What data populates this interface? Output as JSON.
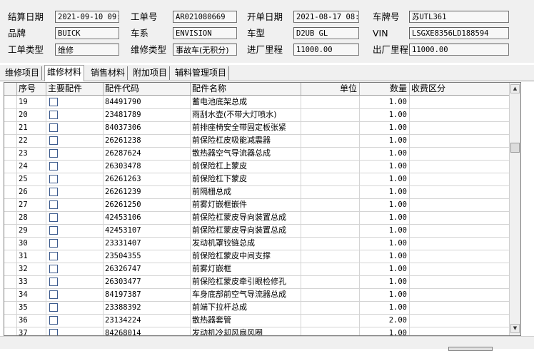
{
  "header": {
    "settle_date_label": "结算日期",
    "settle_date_value": "2021-09-10 09:5",
    "work_order_label": "工单号",
    "work_order_value": "AR021080669",
    "open_date_label": "开单日期",
    "open_date_value": "2021-08-17 08:",
    "plate_label": "车牌号",
    "plate_value": "苏UTL361",
    "brand_label": "品牌",
    "brand_value": "BUICK",
    "series_label": "车系",
    "series_value": "ENVISION",
    "model_label": "车型",
    "model_value": "D2UB GL",
    "vin_label": "VIN",
    "vin_value": "LSGXE8356LD188594",
    "job_type_label": "工单类型",
    "job_type_value": "维修",
    "repair_type_label": "维修类型",
    "repair_type_value": "事故车(无积分)",
    "in_mileage_label": "进厂里程",
    "in_mileage_value": "11000.00",
    "out_mileage_label": "出厂里程",
    "out_mileage_value": "11000.00"
  },
  "tabs": [
    "维修项目",
    "维修材料",
    "销售材料",
    "附加项目",
    "辅料管理项目"
  ],
  "active_tab": "维修材料",
  "table": {
    "columns": [
      "序号",
      "主要配件",
      "配件代码",
      "配件名称",
      "单位",
      "数量",
      "收费区分"
    ],
    "rows": [
      {
        "no": "19",
        "code": "84491790",
        "name": "蓄电池底架总成",
        "unit": "",
        "qty": "1.00",
        "fee": ""
      },
      {
        "no": "20",
        "code": "23481789",
        "name": "雨刮水壶(不带大灯喷水)",
        "unit": "",
        "qty": "1.00",
        "fee": ""
      },
      {
        "no": "21",
        "code": "84037306",
        "name": "前排座椅安全带固定板张紧",
        "unit": "",
        "qty": "1.00",
        "fee": ""
      },
      {
        "no": "22",
        "code": "26261238",
        "name": "前保险杠皮吸能减震器",
        "unit": "",
        "qty": "1.00",
        "fee": ""
      },
      {
        "no": "23",
        "code": "26287624",
        "name": "散热器空气导流器总成",
        "unit": "",
        "qty": "1.00",
        "fee": ""
      },
      {
        "no": "24",
        "code": "26303478",
        "name": "前保险杠上蒙皮",
        "unit": "",
        "qty": "1.00",
        "fee": ""
      },
      {
        "no": "25",
        "code": "26261263",
        "name": "前保险杠下蒙皮",
        "unit": "",
        "qty": "1.00",
        "fee": ""
      },
      {
        "no": "26",
        "code": "26261239",
        "name": "前隔栅总成",
        "unit": "",
        "qty": "1.00",
        "fee": ""
      },
      {
        "no": "27",
        "code": "26261250",
        "name": "前雾灯嵌框嵌件",
        "unit": "",
        "qty": "1.00",
        "fee": ""
      },
      {
        "no": "28",
        "code": "42453106",
        "name": "前保险杠蒙皮导向装置总成",
        "unit": "",
        "qty": "1.00",
        "fee": ""
      },
      {
        "no": "29",
        "code": "42453107",
        "name": "前保险杠蒙皮导向装置总成",
        "unit": "",
        "qty": "1.00",
        "fee": ""
      },
      {
        "no": "30",
        "code": "23331407",
        "name": "发动机罩铰链总成",
        "unit": "",
        "qty": "1.00",
        "fee": ""
      },
      {
        "no": "31",
        "code": "23504355",
        "name": "前保险杠蒙皮中间支撑",
        "unit": "",
        "qty": "1.00",
        "fee": ""
      },
      {
        "no": "32",
        "code": "26326747",
        "name": "前雾灯嵌框",
        "unit": "",
        "qty": "1.00",
        "fee": ""
      },
      {
        "no": "33",
        "code": "26303477",
        "name": "前保险杠蒙皮牵引眼检修孔",
        "unit": "",
        "qty": "1.00",
        "fee": ""
      },
      {
        "no": "34",
        "code": "84197387",
        "name": "车身底部前空气导流器总成",
        "unit": "",
        "qty": "1.00",
        "fee": ""
      },
      {
        "no": "35",
        "code": "23388392",
        "name": "前端下拉杆总成",
        "unit": "",
        "qty": "1.00",
        "fee": ""
      },
      {
        "no": "36",
        "code": "23134224",
        "name": "散热器套管",
        "unit": "",
        "qty": "2.00",
        "fee": ""
      },
      {
        "no": "37",
        "code": "84268014",
        "name": "发动机冷却风扇风圈",
        "unit": "",
        "qty": "1.00",
        "fee": ""
      }
    ]
  },
  "icons": {
    "scroll_up": "scroll-up-arrow-icon",
    "scroll_down": "scroll-down-arrow-icon"
  }
}
